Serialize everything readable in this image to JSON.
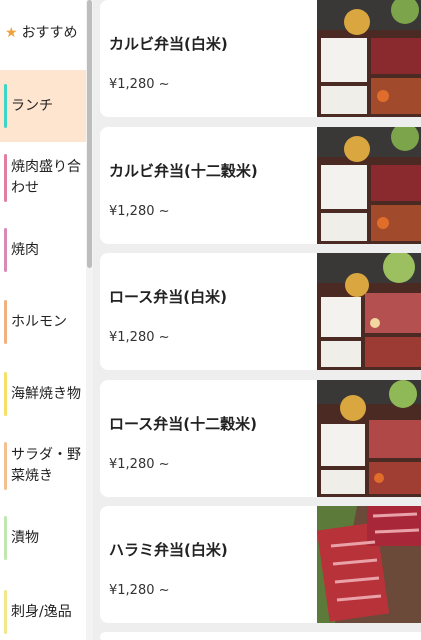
{
  "sidebar": {
    "items": [
      {
        "label": "おすすめ",
        "icon": "star-icon",
        "accent": "#f0a03c"
      },
      {
        "label": "ランチ",
        "accent": "#3dd6c6",
        "active": true
      },
      {
        "label": "焼肉盛り合わせ",
        "accent": "#e07fa0"
      },
      {
        "label": "焼肉",
        "accent": "#d78ab8"
      },
      {
        "label": "ホルモン",
        "accent": "#f0b080"
      },
      {
        "label": "海鮮焼き物",
        "accent": "#f6e06a"
      },
      {
        "label": "サラダ・野菜焼き",
        "accent": "#f4c090"
      },
      {
        "label": "漬物",
        "accent": "#bfe8b0"
      },
      {
        "label": "刺身/逸品",
        "accent": "#f2e78a"
      }
    ]
  },
  "menu": {
    "items": [
      {
        "name": "カルビ弁当(白米)",
        "price": "¥1,280 ~",
        "image": "bento-photo"
      },
      {
        "name": "カルビ弁当(十二穀米)",
        "price": "¥1,280 ~",
        "image": "bento-photo"
      },
      {
        "name": "ロース弁当(白米)",
        "price": "¥1,280 ~",
        "image": "bento-photo"
      },
      {
        "name": "ロース弁当(十二穀米)",
        "price": "¥1,280 ~",
        "image": "bento-photo"
      },
      {
        "name": "ハラミ弁当(白米)",
        "price": "¥1,280 ~",
        "image": "harami-photo"
      }
    ]
  }
}
